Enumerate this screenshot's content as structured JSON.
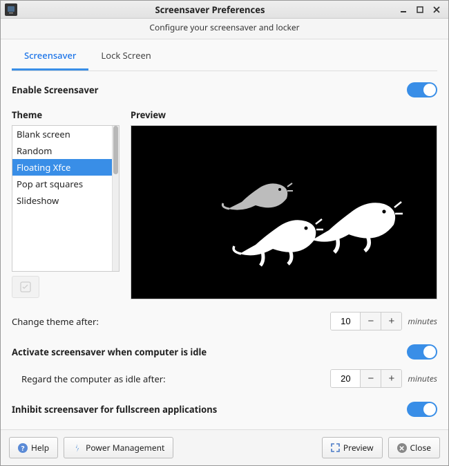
{
  "window": {
    "title": "Screensaver Preferences",
    "subtitle": "Configure your screensaver and locker"
  },
  "tabs": [
    {
      "label": "Screensaver",
      "active": true
    },
    {
      "label": "Lock Screen",
      "active": false
    }
  ],
  "enable": {
    "label": "Enable Screensaver",
    "value": true
  },
  "theme": {
    "header": "Theme",
    "items": [
      "Blank screen",
      "Random",
      "Floating Xfce",
      "Pop art squares",
      "Slideshow"
    ],
    "selected_index": 2
  },
  "preview": {
    "header": "Preview"
  },
  "change_theme": {
    "label": "Change theme after:",
    "value": "10",
    "unit": "minutes"
  },
  "activate_idle": {
    "label": "Activate screensaver when computer is idle",
    "value": true
  },
  "idle_after": {
    "label": "Regard the computer as idle after:",
    "value": "20",
    "unit": "minutes"
  },
  "inhibit_fullscreen": {
    "label": "Inhibit screensaver for fullscreen applications",
    "value": true
  },
  "buttons": {
    "help": "Help",
    "power": "Power Management",
    "preview": "Preview",
    "close": "Close"
  }
}
